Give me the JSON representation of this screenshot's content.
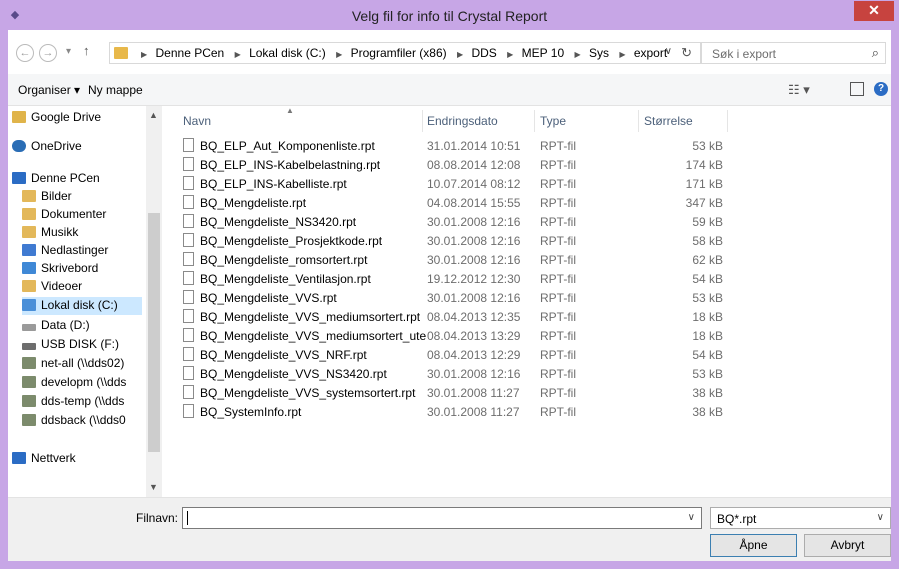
{
  "window": {
    "title": "Velg fil for info til Crystal Report",
    "close_glyph": "✕"
  },
  "address": {
    "crumbs": [
      "Denne PCen",
      "Lokal disk (C:)",
      "Programfiler (x86)",
      "DDS",
      "MEP 10",
      "Sys",
      "export"
    ],
    "search_placeholder": "Søk i export"
  },
  "toolbar": {
    "organize_label": "Organiser ▾",
    "new_folder_label": "Ny mappe"
  },
  "nav": {
    "items": [
      {
        "label": "Google Drive",
        "icon": "google-drive-icon",
        "color": "#e0b44a"
      },
      {
        "label": "OneDrive",
        "icon": "onedrive-icon",
        "color": "#2a6db5"
      },
      {
        "label": "Denne PCen",
        "icon": "computer-icon",
        "color": "#2b6cc4"
      },
      {
        "label": "Bilder",
        "icon": "pictures-folder-icon",
        "color": "#e3b85a"
      },
      {
        "label": "Dokumenter",
        "icon": "documents-folder-icon",
        "color": "#e3b85a"
      },
      {
        "label": "Musikk",
        "icon": "music-folder-icon",
        "color": "#e3b85a"
      },
      {
        "label": "Nedlastinger",
        "icon": "downloads-folder-icon",
        "color": "#3f7ad1"
      },
      {
        "label": "Skrivebord",
        "icon": "desktop-folder-icon",
        "color": "#3f88d6"
      },
      {
        "label": "Videoer",
        "icon": "videos-folder-icon",
        "color": "#e3b85a"
      },
      {
        "label": "Lokal disk (C:)",
        "icon": "local-disk-icon",
        "color": "#4a8fd8"
      },
      {
        "label": "Data (D:)",
        "icon": "drive-icon",
        "color": "#9a9a9a"
      },
      {
        "label": "USB DISK (F:)",
        "icon": "usb-drive-icon",
        "color": "#6d6d6d"
      },
      {
        "label": "net-all (\\\\dds02)",
        "icon": "network-drive-icon",
        "color": "#7c8b6c"
      },
      {
        "label": "developm (\\\\dds",
        "icon": "network-drive-icon",
        "color": "#7c8b6c"
      },
      {
        "label": "dds-temp (\\\\dds",
        "icon": "network-drive-icon",
        "color": "#7c8b6c"
      },
      {
        "label": "ddsback (\\\\dds0",
        "icon": "network-drive-icon",
        "color": "#7c8b6c"
      },
      {
        "label": "Nettverk",
        "icon": "network-icon",
        "color": "#2b6cc4"
      }
    ]
  },
  "columns": {
    "name": "Navn",
    "date": "Endringsdato",
    "type": "Type",
    "size": "Størrelse"
  },
  "files": [
    {
      "name": "BQ_ELP_Aut_Komponenliste.rpt",
      "date": "31.01.2014 10:51",
      "type": "RPT-fil",
      "size": "53 kB"
    },
    {
      "name": "BQ_ELP_INS-Kabelbelastning.rpt",
      "date": "08.08.2014 12:08",
      "type": "RPT-fil",
      "size": "174 kB"
    },
    {
      "name": "BQ_ELP_INS-Kabelliste.rpt",
      "date": "10.07.2014 08:12",
      "type": "RPT-fil",
      "size": "171 kB"
    },
    {
      "name": "BQ_Mengdeliste.rpt",
      "date": "04.08.2014 15:55",
      "type": "RPT-fil",
      "size": "347 kB"
    },
    {
      "name": "BQ_Mengdeliste_NS3420.rpt",
      "date": "30.01.2008 12:16",
      "type": "RPT-fil",
      "size": "59 kB"
    },
    {
      "name": "BQ_Mengdeliste_Prosjektkode.rpt",
      "date": "30.01.2008 12:16",
      "type": "RPT-fil",
      "size": "58 kB"
    },
    {
      "name": "BQ_Mengdeliste_romsortert.rpt",
      "date": "30.01.2008 12:16",
      "type": "RPT-fil",
      "size": "62 kB"
    },
    {
      "name": "BQ_Mengdeliste_Ventilasjon.rpt",
      "date": "19.12.2012 12:30",
      "type": "RPT-fil",
      "size": "54 kB"
    },
    {
      "name": "BQ_Mengdeliste_VVS.rpt",
      "date": "30.01.2008 12:16",
      "type": "RPT-fil",
      "size": "53 kB"
    },
    {
      "name": "BQ_Mengdeliste_VVS_mediumsortert.rpt",
      "date": "08.04.2013 12:35",
      "type": "RPT-fil",
      "size": "18 kB"
    },
    {
      "name": "BQ_Mengdeliste_VVS_mediumsortert_ute...",
      "date": "08.04.2013 13:29",
      "type": "RPT-fil",
      "size": "18 kB"
    },
    {
      "name": "BQ_Mengdeliste_VVS_NRF.rpt",
      "date": "08.04.2013 12:29",
      "type": "RPT-fil",
      "size": "54 kB"
    },
    {
      "name": "BQ_Mengdeliste_VVS_NS3420.rpt",
      "date": "30.01.2008 12:16",
      "type": "RPT-fil",
      "size": "53 kB"
    },
    {
      "name": "BQ_Mengdeliste_VVS_systemsortert.rpt",
      "date": "30.01.2008 11:27",
      "type": "RPT-fil",
      "size": "38 kB"
    },
    {
      "name": "BQ_SystemInfo.rpt",
      "date": "30.01.2008 11:27",
      "type": "RPT-fil",
      "size": "38 kB"
    }
  ],
  "footer": {
    "filename_label": "Filnavn:",
    "filename_value": "",
    "filter_value": "BQ*.rpt",
    "open_label": "Åpne",
    "cancel_label": "Avbryt"
  }
}
